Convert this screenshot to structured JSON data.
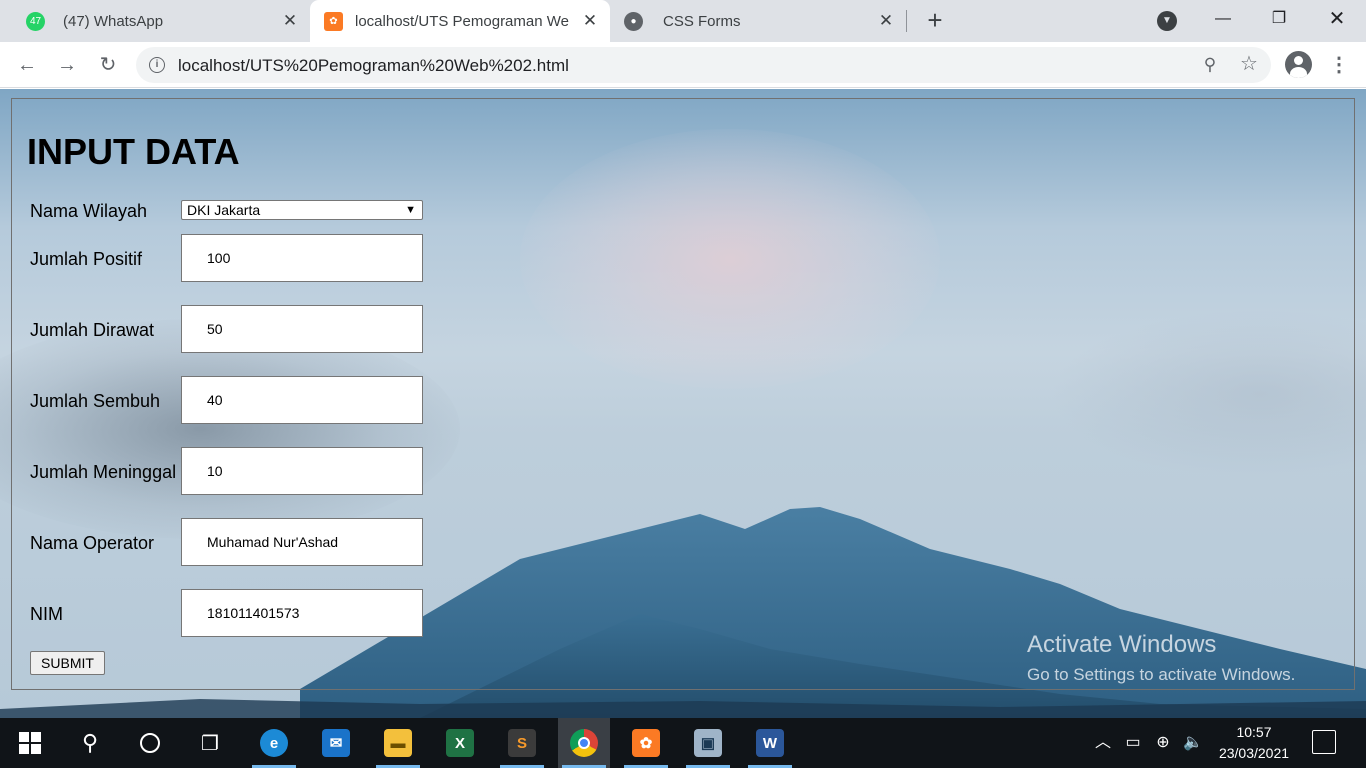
{
  "browser": {
    "tabs": [
      {
        "title": "(47) WhatsApp",
        "badge": "47",
        "icon": "whatsapp-icon",
        "active": false
      },
      {
        "title": "localhost/UTS Pemograman Web",
        "icon": "xampp-icon",
        "active": true
      },
      {
        "title": "CSS Forms",
        "icon": "globe-icon",
        "active": false
      }
    ],
    "url": "localhost/UTS%20Pemograman%20Web%202.html"
  },
  "form": {
    "heading": "INPUT DATA",
    "fields": {
      "wilayah": {
        "label": "Nama Wilayah",
        "value": "DKI Jakarta"
      },
      "positif": {
        "label": "Jumlah Positif",
        "value": "100"
      },
      "dirawat": {
        "label": "Jumlah Dirawat",
        "value": "50"
      },
      "sembuh": {
        "label": "Jumlah Sembuh",
        "value": "40"
      },
      "meninggal": {
        "label": "Jumlah Meninggal",
        "value": "10"
      },
      "operator": {
        "label": "Nama Operator",
        "value": "Muhamad Nur'Ashad"
      },
      "nim": {
        "label": "NIM",
        "value": "181011401573"
      }
    },
    "submit_label": "SUBMIT"
  },
  "watermark": {
    "line1": "Activate Windows",
    "line2": "Go to Settings to activate Windows."
  },
  "taskbar": {
    "apps": [
      "start-icon",
      "search-icon",
      "cortana-icon",
      "task-view-icon",
      "edge-icon",
      "mail-icon",
      "file-explorer-icon",
      "excel-icon",
      "sublime-text-icon",
      "chrome-icon",
      "xampp-icon",
      "remote-desktop-icon",
      "word-icon"
    ],
    "time": "10:57",
    "date": "23/03/2021"
  },
  "colors": {
    "tabstrip": "#dee1e6",
    "taskbar": "#101418",
    "accent": "#76b9ed"
  }
}
